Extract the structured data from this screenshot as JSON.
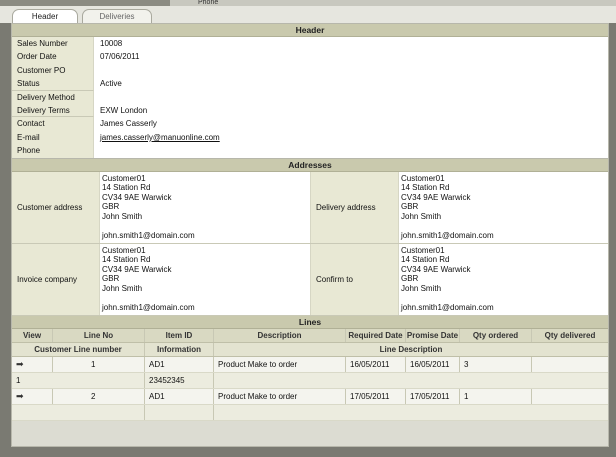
{
  "window": {
    "top_fragment": "Phone"
  },
  "tabs": [
    {
      "label": "Header",
      "active": true
    },
    {
      "label": "Deliveries",
      "active": false
    }
  ],
  "header": {
    "section_title": "Header",
    "fields": [
      {
        "label": "Sales Number",
        "value": "10008"
      },
      {
        "label": "Order Date",
        "value": "07/06/2011"
      },
      {
        "label": "Customer PO",
        "value": ""
      },
      {
        "label": "Status",
        "value": "Active"
      },
      {
        "label": "Delivery Method",
        "value": ""
      },
      {
        "label": "Delivery Terms",
        "value": "EXW London"
      },
      {
        "label": "Contact",
        "value": "James Casserly"
      },
      {
        "label": "E-mail",
        "value": "james.casserly@manuonline.com"
      },
      {
        "label": "Phone",
        "value": ""
      }
    ]
  },
  "addresses": {
    "section_title": "Addresses",
    "customer": {
      "label": "Customer address",
      "lines": [
        "Customer01",
        "14 Station Rd",
        "CV34 9AE Warwick",
        "GBR",
        "John Smith",
        "",
        "john.smith1@domain.com"
      ]
    },
    "delivery": {
      "label": "Delivery address",
      "lines": [
        "Customer01",
        "14 Station Rd",
        "CV34 9AE Warwick",
        "GBR",
        "John Smith",
        "",
        "john.smith1@domain.com"
      ]
    },
    "invoice": {
      "label": "Invoice company",
      "lines": [
        "Customer01",
        "14 Station Rd",
        "CV34 9AE Warwick",
        "GBR",
        "John Smith",
        "",
        "john.smith1@domain.com"
      ]
    },
    "confirm": {
      "label": "Confirm to",
      "lines": [
        "Customer01",
        "14 Station Rd",
        "CV34 9AE Warwick",
        "GBR",
        "John Smith",
        "",
        "john.smith1@domain.com"
      ]
    }
  },
  "lines": {
    "section_title": "Lines",
    "columns": [
      "View",
      "Line No",
      "Item ID",
      "Description",
      "Required Date",
      "Promise Date",
      "Qty ordered",
      "Qty delivered"
    ],
    "subcolumns": [
      "Customer Line number",
      "Information",
      "Line Description"
    ],
    "rows": [
      {
        "view": "➡",
        "line_no": "1",
        "item_id": "AD1",
        "description": "Product Make to order",
        "required": "16/05/2011",
        "promise": "16/05/2011",
        "qty_ordered": "3",
        "qty_delivered": "",
        "customer_line": "1",
        "information": "23452345",
        "line_description": ""
      },
      {
        "view": "➡",
        "line_no": "2",
        "item_id": "AD1",
        "description": "Product Make to order",
        "required": "17/05/2011",
        "promise": "17/05/2011",
        "qty_ordered": "1",
        "qty_delivered": "",
        "customer_line": "",
        "information": "",
        "line_description": ""
      }
    ]
  }
}
